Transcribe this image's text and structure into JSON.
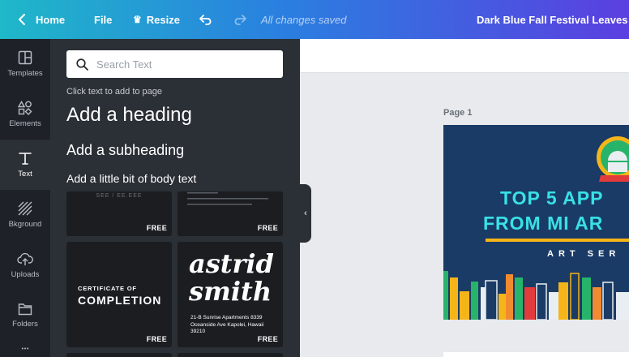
{
  "topbar": {
    "home_label": "Home",
    "file_label": "File",
    "resize_label": "Resize",
    "saved_status": "All changes saved",
    "doc_title": "Dark Blue Fall Festival Leaves Fac"
  },
  "sidebar": {
    "items": [
      {
        "label": "Templates",
        "icon": "templates-icon"
      },
      {
        "label": "Elements",
        "icon": "elements-icon"
      },
      {
        "label": "Text",
        "icon": "text-icon"
      },
      {
        "label": "Bkground",
        "icon": "background-icon"
      },
      {
        "label": "Uploads",
        "icon": "uploads-icon"
      },
      {
        "label": "Folders",
        "icon": "folders-icon"
      }
    ],
    "active": "Text"
  },
  "text_panel": {
    "search_placeholder": "Search Text",
    "hint": "Click text to add to page",
    "add_heading": "Add a heading",
    "add_subheading": "Add a little bit of body text",
    "add_subheading_label": "Add a subheading",
    "templates": [
      {
        "badge": "FREE",
        "preview": "SEE / EE.EEE"
      },
      {
        "badge": "FREE"
      },
      {
        "badge": "FREE",
        "small": "CERTIFICATE OF",
        "big": "COMPLETION"
      },
      {
        "badge": "FREE",
        "line1": "astrid",
        "line2": "smith",
        "address": "21-B Sunrise Apartments 8339 Oceanside Ave Kapolei, Hawaii 39210"
      }
    ]
  },
  "canvas": {
    "page_label": "Page 1",
    "design": {
      "line1": "TOP 5 APP",
      "line2": "FROM MI AR",
      "subtitle": "ART SER",
      "colors": {
        "background": "#1a3b66",
        "headline": "#38e1e6",
        "accent": "#f5b519"
      }
    }
  }
}
